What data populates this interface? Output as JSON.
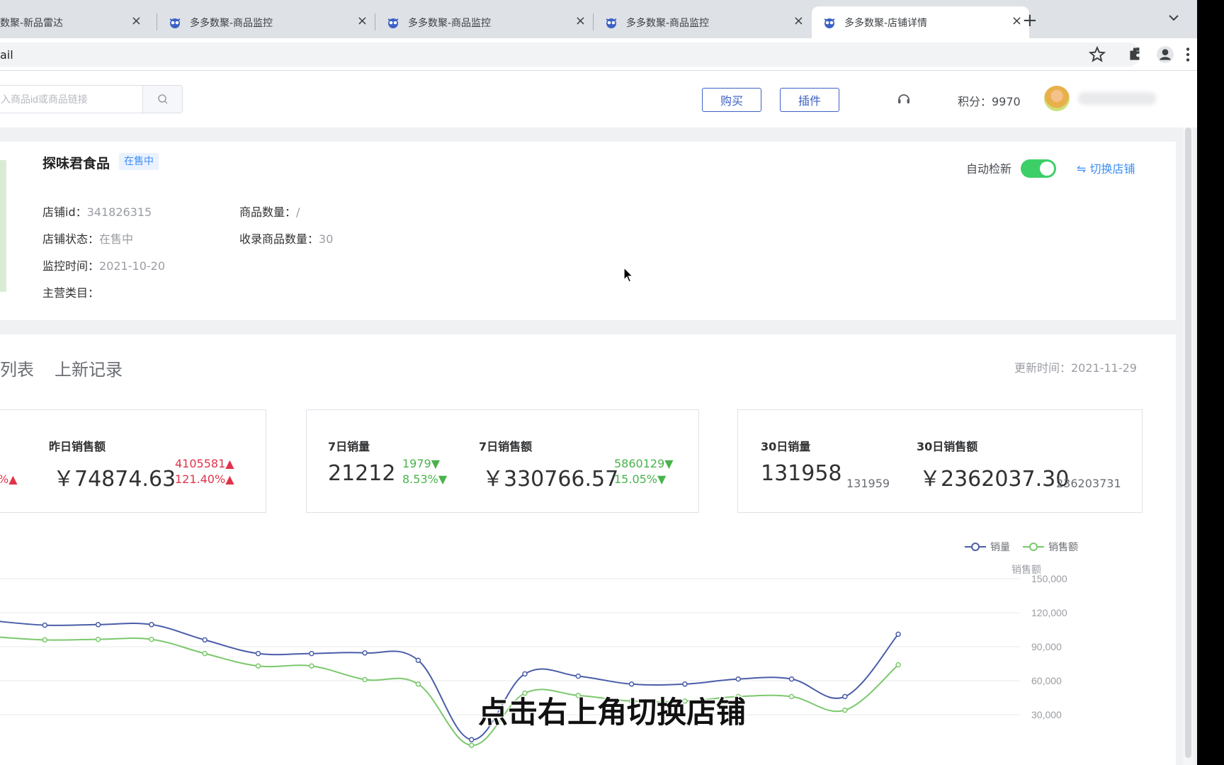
{
  "browser": {
    "tabs": [
      {
        "title": "数聚-新品雷达"
      },
      {
        "title": "多多数聚-商品监控"
      },
      {
        "title": "多多数聚-商品监控"
      },
      {
        "title": "多多数聚-商品监控"
      },
      {
        "title": "多多数聚-店铺详情"
      }
    ],
    "close_glyph": "×",
    "new_tab_glyph": "+",
    "url": "ail",
    "icons": [
      "star-icon",
      "extension-icon",
      "profile-icon",
      "kebab-menu-icon"
    ]
  },
  "header": {
    "search_placeholder": "入商品id或商品链接",
    "buy_label": "购买",
    "plugin_label": "插件",
    "points": "积分：9970"
  },
  "shop": {
    "name": "探味君食品",
    "badge": "在售中",
    "fields": [
      {
        "label": "店铺id：",
        "value": "341826315"
      },
      {
        "label": "商品数量：",
        "value": "/"
      },
      {
        "label": "店铺状态：",
        "value": "在售中"
      },
      {
        "label": "收录商品数量：",
        "value": "30"
      },
      {
        "label": "监控时间：",
        "value": "2021-10-20"
      },
      {
        "label": "主营类目：",
        "value": ""
      }
    ],
    "auto_refresh_label": "自动检新",
    "auto_refresh_on": true,
    "switch_shop_label": "⇋ 切换店铺"
  },
  "panel": {
    "tabs": [
      "列表",
      "上新记录"
    ],
    "update_time": "更新时间：2021-11-29",
    "cards": [
      {
        "partial_left": "%▲",
        "label": "昨日销售额",
        "value": "￥74874.63",
        "sub1": "4105581▲",
        "sub2": "121.40%▲"
      },
      {
        "label_a": "7日销量",
        "value_a": "21212",
        "sub_a1": "1979▼",
        "sub_a2": "8.53%▼",
        "label_b": "7日销售额",
        "value_b": "￥330766.57",
        "sub_b1": "5860129▼",
        "sub_b2": "15.05%▼"
      },
      {
        "label_a": "30日销量",
        "value_a": "131958",
        "sub_a": "131959",
        "label_b": "30日销售额",
        "value_b": "￥2362037.30",
        "sub_b": "236203731"
      }
    ]
  },
  "chart_data": {
    "type": "line",
    "y_axis_label": "销售额",
    "ylim": [
      0,
      150000
    ],
    "y_ticks": [
      "150,000",
      "120,000",
      "90,000",
      "60,000",
      "30,000"
    ],
    "y_tick_values": [
      150000,
      120000,
      90000,
      60000,
      30000
    ],
    "grid": true,
    "legend_position": "top-right",
    "series": [
      {
        "name": "销量",
        "color": "#4a5da8",
        "values": [
          113000,
          109000,
          109500,
          109500,
          96000,
          84000,
          84000,
          84500,
          78000,
          8000,
          66000,
          64000,
          57000,
          57000,
          61500,
          61500,
          46000,
          101000
        ]
      },
      {
        "name": "销售额",
        "color": "#7bc86c",
        "values": [
          99000,
          96000,
          96500,
          96500,
          84000,
          73000,
          73000,
          61000,
          57000,
          3000,
          49000,
          47000,
          42000,
          42000,
          46000,
          46000,
          34000,
          74000
        ]
      }
    ]
  },
  "overlay": {
    "caption": "点击右上角切换店铺"
  }
}
